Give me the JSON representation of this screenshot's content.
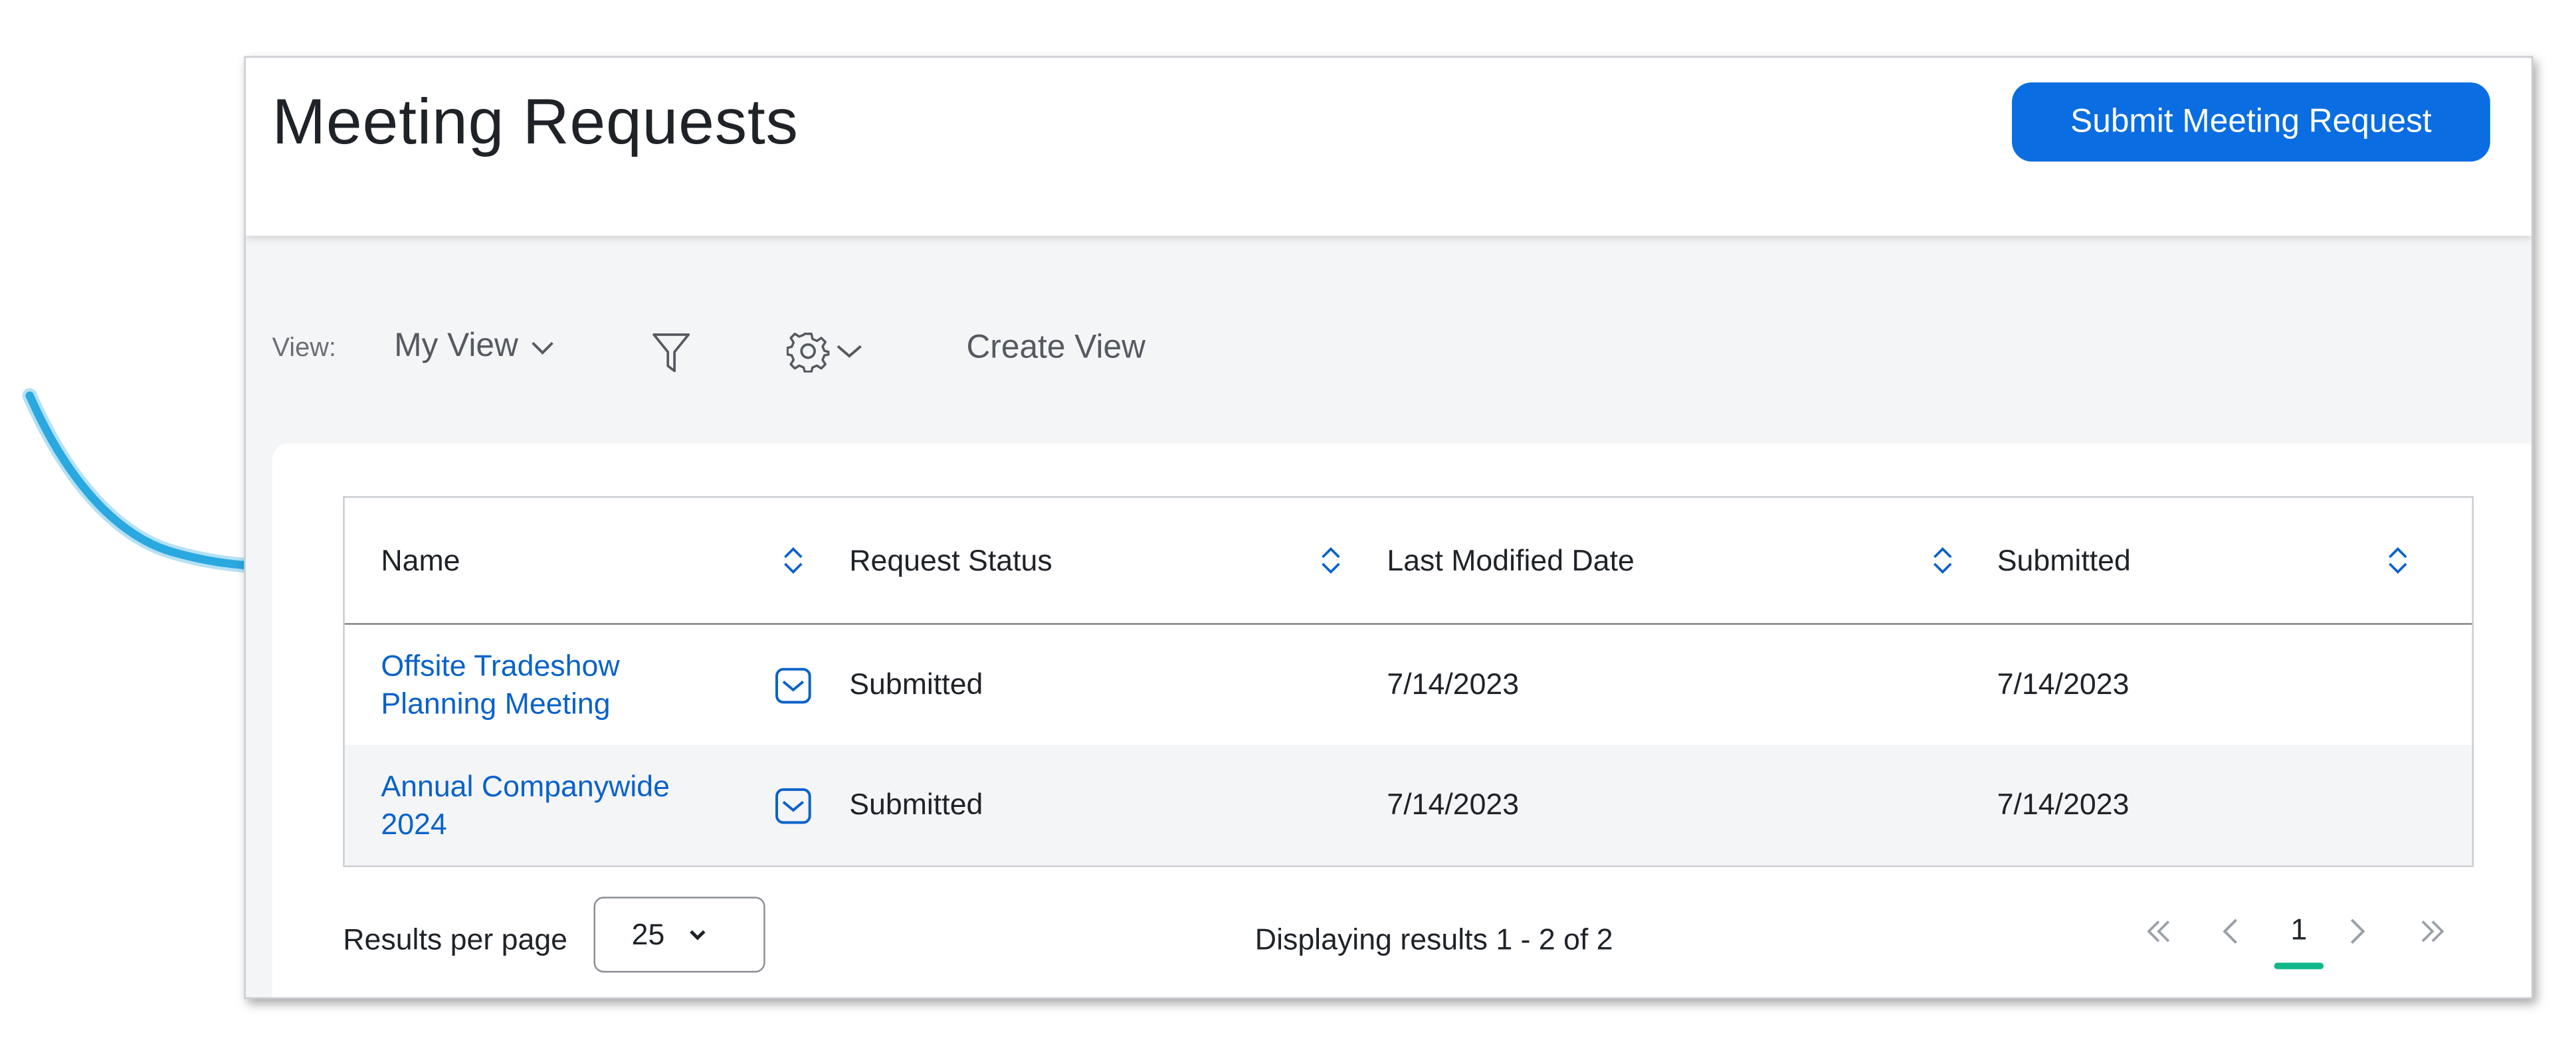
{
  "header": {
    "title": "Meeting Requests",
    "submit_label": "Submit Meeting Request"
  },
  "toolbar": {
    "view_label": "View:",
    "view_value": "My View",
    "create_view_label": "Create View"
  },
  "table": {
    "columns": [
      "Name",
      "Request Status",
      "Last Modified Date",
      "Submitted"
    ],
    "rows": [
      {
        "name": "Offsite Tradeshow Planning Meeting",
        "status": "Submitted",
        "modified": "7/14/2023",
        "submitted": "7/14/2023"
      },
      {
        "name": "Annual Companywide 2024",
        "status": "Submitted",
        "modified": "7/14/2023",
        "submitted": "7/14/2023"
      }
    ]
  },
  "footer": {
    "results_per_page_label": "Results per page",
    "results_per_page_value": "25",
    "displaying_text": "Displaying results 1 - 2 of 2",
    "current_page": "1"
  },
  "colors": {
    "accent": "#0a6de1",
    "link": "#0a62c9",
    "annotation_arrow": "#2aa8e0",
    "page_indicator": "#13b88a"
  }
}
